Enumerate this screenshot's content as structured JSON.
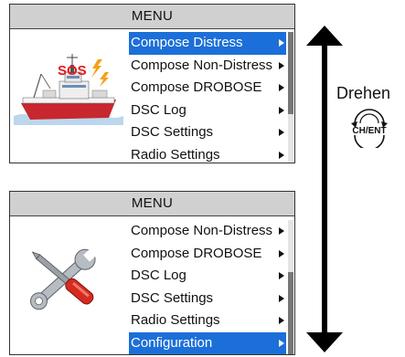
{
  "screens": [
    {
      "title": "MENU",
      "items": [
        {
          "label": "Compose Distress",
          "selected": true
        },
        {
          "label": "Compose Non-Distress",
          "selected": false
        },
        {
          "label": "Compose DROBOSE",
          "selected": false
        },
        {
          "label": "DSC Log",
          "selected": false
        },
        {
          "label": "DSC Settings",
          "selected": false
        },
        {
          "label": "Radio Settings",
          "selected": false
        }
      ],
      "illustration": {
        "icon": "distress-ship-icon",
        "text": "SOS"
      }
    },
    {
      "title": "MENU",
      "items": [
        {
          "label": "Compose Non-Distress",
          "selected": false
        },
        {
          "label": "Compose DROBOSE",
          "selected": false
        },
        {
          "label": "DSC Log",
          "selected": false
        },
        {
          "label": "DSC Settings",
          "selected": false
        },
        {
          "label": "Radio Settings",
          "selected": false
        },
        {
          "label": "Configuration",
          "selected": true
        }
      ],
      "illustration": {
        "icon": "wrench-screwdriver-icon"
      }
    }
  ],
  "side": {
    "label": "Drehen",
    "dial_text": "CH/ENT",
    "dial_icon": "rotary-dial-icon"
  },
  "colors": {
    "selected": "#1c6fd8",
    "sos": "#e0191b"
  }
}
